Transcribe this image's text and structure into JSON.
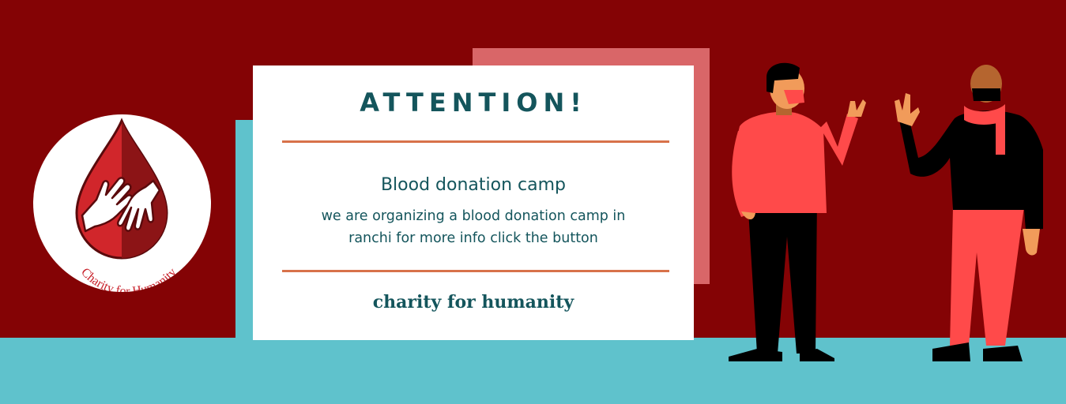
{
  "card": {
    "title": "ATTENTION!",
    "subtitle": "Blood donation camp",
    "body_line1": "we are organizing a blood donation camp in",
    "body_line2": "ranchi for more info click the button",
    "footer": "charity for humanity"
  },
  "logo": {
    "text": "Charity for Humanity",
    "icon": "blood-drop-hands-icon"
  },
  "colors": {
    "background": "#840305",
    "teal": "#5fc2cc",
    "pink": "#d96668",
    "text": "#14555c",
    "rule": "#d8724a",
    "red_shirt": "#ff4a4a"
  }
}
